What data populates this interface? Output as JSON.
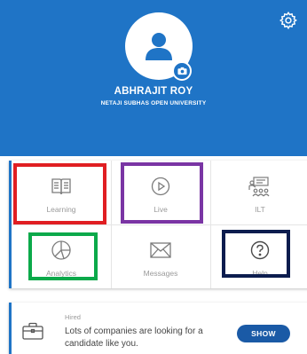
{
  "profile": {
    "name": "ABHRAJIT ROY",
    "organization": "NETAJI SUBHAS OPEN UNIVERSITY"
  },
  "menu": {
    "items": [
      {
        "label": "Learning",
        "icon": "book-icon"
      },
      {
        "label": "Live",
        "icon": "play-icon"
      },
      {
        "label": "ILT",
        "icon": "classroom-icon"
      },
      {
        "label": "Analytics",
        "icon": "pie-chart-icon"
      },
      {
        "label": "Messages",
        "icon": "envelope-icon"
      },
      {
        "label": "Help",
        "icon": "help-icon"
      }
    ]
  },
  "highlights": {
    "colors": {
      "red": "#e01e22",
      "purple": "#7a35a4",
      "green": "#0ba94a",
      "navy": "#0c1c4e"
    }
  },
  "hire": {
    "tag": "Hired",
    "message": "Lots of companies are looking for a candidate like you.",
    "button": "SHOW"
  },
  "colors": {
    "brand": "#1f74c6",
    "button": "#1a5aa6"
  }
}
